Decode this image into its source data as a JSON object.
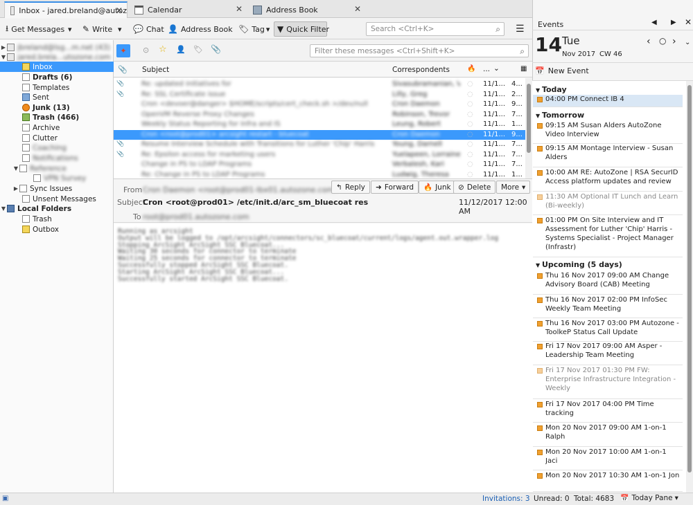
{
  "tabs": [
    {
      "label": "Inbox - jared.breland@autoz"
    },
    {
      "label": "Calendar"
    },
    {
      "label": "Address Book"
    }
  ],
  "toolbar": {
    "get_messages": "Get Messages",
    "write": "Write",
    "chat": "Chat",
    "address_book": "Address Book",
    "tag": "Tag",
    "quick_filter": "Quick Filter",
    "search_placeholder": "Search <Ctrl+K>"
  },
  "quickfilter": {
    "placeholder": "Filter these messages <Ctrl+Shift+K>"
  },
  "folders": {
    "account1": "jbreland@lsg...m.net (43)",
    "account2": "jared.brela...utozone.com",
    "inbox": "Inbox",
    "drafts": "Drafts (6)",
    "templates": "Templates",
    "sent": "Sent",
    "junk": "Junk (13)",
    "trash": "Trash (466)",
    "archive": "Archive",
    "clutter": "Clutter",
    "coaching": "Coaching",
    "notifications": "Notifications",
    "reference": "Reference",
    "vpn": "VPN Survey",
    "sync_issues": "Sync Issues",
    "unsent": "Unsent Messages",
    "local_folders": "Local Folders",
    "local_trash": "Trash",
    "outbox": "Outbox"
  },
  "columns": {
    "subject": "Subject",
    "correspondents": "Correspondents",
    "more": "...",
    "size": ""
  },
  "messages": [
    {
      "subject": "Re: updated initiatives for",
      "from": "Sivasubramanian, V...",
      "date": "11/1...",
      "size": "4..."
    },
    {
      "subject": "Re: SSL Certificate issue",
      "from": "Lilly, Greg",
      "date": "11/1...",
      "size": "2..."
    },
    {
      "subject": "Cron <devoer@danger> $HOME/scripts/cert_check.sh >/dev/null",
      "from": "Cron Daemon",
      "date": "11/1...",
      "size": "9..."
    },
    {
      "subject": "OpenVM Reverse Proxy Changes",
      "from": "Robinson, Trevor",
      "date": "11/1...",
      "size": "7..."
    },
    {
      "subject": "Weekly Status Reporting for Infra and IS",
      "from": "Leung, Robert",
      "date": "11/1...",
      "size": "1..."
    },
    {
      "subject": "Cron <root@prod01> arcsight restart - bluecoat",
      "from": "Cron Daemon",
      "date": "11/1...",
      "size": "9..."
    },
    {
      "subject": "Resume Interview Schedule with Transitions for Luther 'Chip' Harris - IT...",
      "from": "Young, Darnell",
      "date": "11/1...",
      "size": "7..."
    },
    {
      "subject": "Re: Epsilon access for marketing users",
      "from": "Yuelapeen, Lorraine",
      "date": "11/1...",
      "size": "7..."
    },
    {
      "subject": "Change in PS to LDAP Programs",
      "from": "Verbalesh, Kari",
      "date": "11/1...",
      "size": "7..."
    },
    {
      "subject": "Re: Change in PS to LDAP Programs",
      "from": "Ludwig, Theresa",
      "date": "11/1...",
      "size": "1..."
    }
  ],
  "header": {
    "from_label": "From",
    "from_value": "Cron Daemon <root@prod01-lbx01.autozone.com>",
    "subject_label": "Subject",
    "subject_value": "Cron <root@prod01> /etc/init.d/arc_sm_bluecoat restart",
    "to_label": "To",
    "to_value": "root@prod01.autozone.com",
    "date": "11/12/2017 12:00 AM"
  },
  "actions": {
    "reply": "Reply",
    "forward": "Forward",
    "junk": "Junk",
    "delete": "Delete",
    "more": "More"
  },
  "body_lines": [
    "Running as arcsight",
    "Output will be logged to /opt/arcsight/connectors/sc_bluecoat/current/logs/agent.out.wrapper.log",
    "Stopping ArcSight ArcSight SSC Bluecoat...",
    "Waiting 30 seconds for connector to terminate",
    "Waiting 25 seconds for connector to terminate",
    "Successfully stopped ArcSight SSC Bluecoat.",
    "Starting ArcSight ArcSight SSC Bluecoat...",
    "Successfully started ArcSight SSC Bluecoat."
  ],
  "events": {
    "title": "Events",
    "day": "14",
    "weekday": "Tue",
    "month_year": "Nov 2017",
    "week": "CW 46",
    "new_event": "New Event",
    "today": "Today",
    "tomorrow": "Tomorrow",
    "upcoming": "Upcoming (5 days)",
    "items": [
      {
        "text": "04:00 PM Connect IB 4",
        "kind": "today"
      },
      {
        "text": "09:15 AM Susan Alders AutoZone Video Interview",
        "kind": "normal"
      },
      {
        "text": "09:15 AM Montage Interview - Susan Alders",
        "kind": "normal"
      },
      {
        "text": "10:00 AM RE: AutoZone | RSA SecurID Access platform updates and review",
        "kind": "normal"
      },
      {
        "text": "11:30 AM Optional IT Lunch and Learn (Bi-weekly)",
        "kind": "dim"
      },
      {
        "text": "01:00 PM On Site Interview and IT Assessment for Luther 'Chip' Harris - Systems Specialist - Project Manager (Infrastr)",
        "kind": "normal"
      },
      {
        "text": "Thu 16 Nov 2017 09:00 AM Change Advisory Board (CAB) Meeting",
        "kind": "normal"
      },
      {
        "text": "Thu 16 Nov 2017 02:00 PM InfoSec Weekly Team Meeting",
        "kind": "normal"
      },
      {
        "text": "Thu 16 Nov 2017 03:00 PM Autozone - ToolkeP Status Call Update",
        "kind": "normal"
      },
      {
        "text": "Fri 17 Nov 2017 09:00 AM Asper - Leadership Team Meeting",
        "kind": "normal"
      },
      {
        "text": "Fri 17 Nov 2017 01:30 PM FW: Enterprise Infrastructure Integration - Weekly",
        "kind": "dim"
      },
      {
        "text": "Fri 17 Nov 2017 04:00 PM Time tracking",
        "kind": "normal"
      },
      {
        "text": "Mon 20 Nov 2017 09:00 AM 1-on-1 Ralph",
        "kind": "normal"
      },
      {
        "text": "Mon 20 Nov 2017 10:00 AM 1-on-1 Jaci",
        "kind": "normal"
      },
      {
        "text": "Mon 20 Nov 2017 10:30 AM 1-on-1 Jon",
        "kind": "normal"
      }
    ]
  },
  "status": {
    "invitations": "Invitations: 3",
    "unread": "Unread: 0",
    "total": "Total: 4683",
    "today_pane": "Today Pane"
  }
}
